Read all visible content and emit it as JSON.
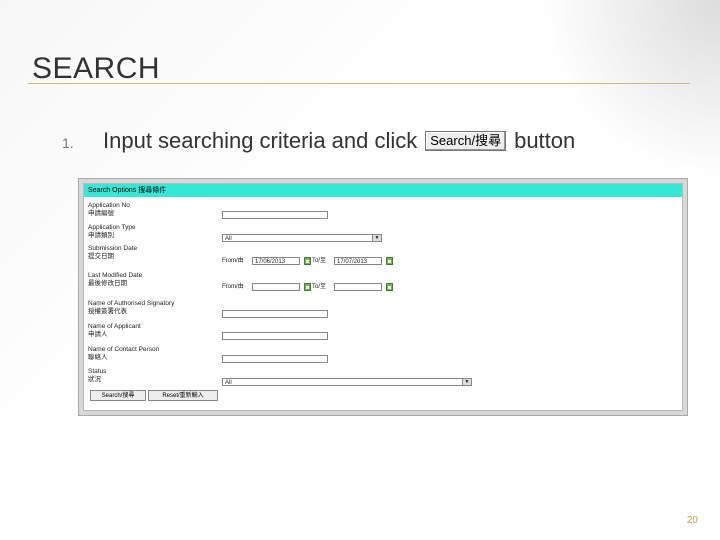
{
  "slide": {
    "title": "SEARCH",
    "bullet_number": "1.",
    "instruction_before": "Input searching criteria and click",
    "instruction_button": "Search/搜尋",
    "instruction_after": "button",
    "page_number": "20"
  },
  "form": {
    "header": "Search Options 搜尋條件",
    "application_no_label": "Application No",
    "application_no_label_zh": "申請編號",
    "application_type_label": "Application Type",
    "application_type_label_zh": "申請類別",
    "application_type_value": "All",
    "submission_date_label": "Submission Date",
    "submission_date_label_zh": "提交日期",
    "from_label": "From/由",
    "to_label": "To/至",
    "submission_from_value": "17/06/2013",
    "submission_to_value": "17/07/2013",
    "last_modified_label": "Last Modified Date",
    "last_modified_label_zh": "最後修改日期",
    "signatory_label": "Name of Authorised Signatory",
    "signatory_label_zh": "授權簽署代表",
    "applicant_label": "Name of Applicant",
    "applicant_label_zh": "申請人",
    "contact_label": "Name of Contact Person",
    "contact_label_zh": "聯絡人",
    "status_label": "Status",
    "status_label_zh": "狀況",
    "status_value": "All",
    "search_button": "Search/搜尋",
    "reset_button": "Reset/重新輸入"
  }
}
